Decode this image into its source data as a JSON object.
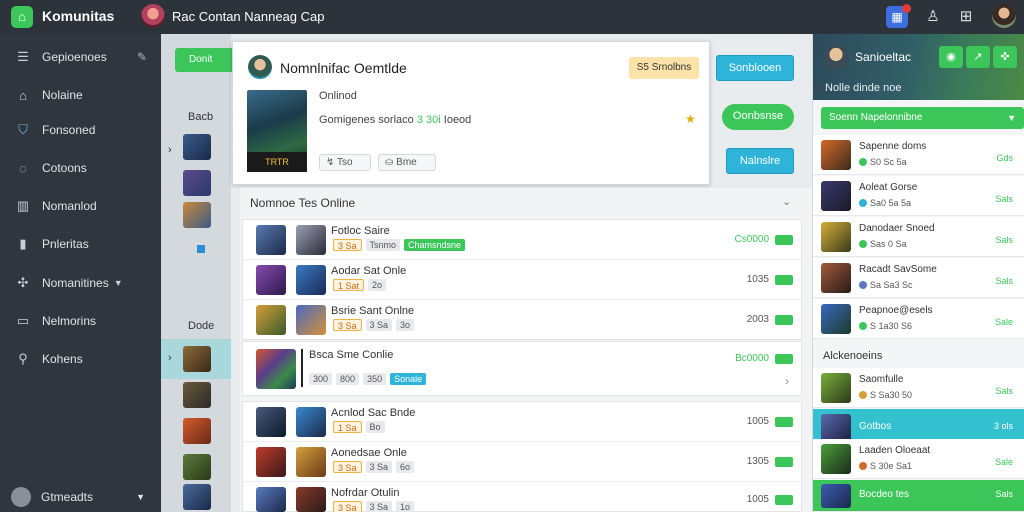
{
  "app": {
    "brand": "Komunitas",
    "title": "Rac Contan Nanneag Cap"
  },
  "topbar": {
    "notif_icon": "notification-icon",
    "user_icon": "user-icon",
    "grid_icon": "grid-icon"
  },
  "sidebar": {
    "items": [
      {
        "label": "Gepioenoes",
        "icon": "menu-icon"
      },
      {
        "label": "Nolaine",
        "icon": "home-icon"
      },
      {
        "label": "Fonsoned",
        "icon": "shield-icon"
      },
      {
        "label": "Cotoons",
        "icon": "chat-icon"
      },
      {
        "label": "Nomanlod",
        "icon": "building-icon"
      },
      {
        "label": "Pnleritas",
        "icon": "bookmark-icon"
      },
      {
        "label": "Nomanitines",
        "icon": "puzzle-icon"
      },
      {
        "label": "Nelmorins",
        "icon": "monitor-icon"
      },
      {
        "label": "Kohens",
        "icon": "location-icon"
      }
    ],
    "footer": "Gtmeadts"
  },
  "under": {
    "button": "Donit",
    "header1": "Bacb",
    "header2": "Dode"
  },
  "popup": {
    "title": "Nomnlnifac Oemtlde",
    "badge": "S5 Srnolbns",
    "status": "Onlinod",
    "desc_prefix": "Gomigenes sorlaco",
    "desc_highlight": "3 30i",
    "desc_suffix": "Ioeod",
    "art_label": "TRTR",
    "tag1": "Tso",
    "tag2": "Bme"
  },
  "actions": {
    "btn1": "Sonblooen",
    "btn2": "Oonbsnse",
    "btn3": "Nalnslre"
  },
  "main": {
    "section": "Nomnoe Tes Online",
    "rows": [
      {
        "name": "Fotloc Saire",
        "tags": [
          "3 Sa",
          "Tsnmo",
          "Chamsndsne"
        ],
        "value": "Cs0000",
        "green": true
      },
      {
        "name": "Aodar Sat Onle",
        "tags": [
          "1 Sat",
          "2o"
        ],
        "value": "1035",
        "green": false
      },
      {
        "name": "Bsrie Sant Onlne",
        "tags": [
          "3 Sa",
          "3 Sa",
          "3o"
        ],
        "value": "2003",
        "green": false
      }
    ],
    "big_row": {
      "name": "Bsca Sme Conlie",
      "tags": [
        "300",
        "800",
        "350",
        "Sonale"
      ],
      "value": "Bc0000"
    },
    "rows2": [
      {
        "name": "Acnlod Sac Bnde",
        "tags": [
          "1 Sa",
          "Bo"
        ],
        "value": "1005"
      },
      {
        "name": "Aonedsae Onle",
        "tags": [
          "3 Sa",
          "3 Sa",
          "6o"
        ],
        "value": "1305"
      },
      {
        "name": "Nofrdar Otulin",
        "tags": [
          "3 Sa",
          "3 Sa",
          "1o"
        ],
        "value": "1005"
      }
    ]
  },
  "right": {
    "name": "Sanioeltac",
    "subtitle": "Nolle dinde noe",
    "dropdown": "Soenn Napelonnibne",
    "rows": [
      {
        "name": "Sapenne doms",
        "meta": "S0 Sc 5a",
        "value": "Gds"
      },
      {
        "name": "Aoleat Gorse",
        "meta": "Sa0 5a 5a",
        "value": "Sals"
      },
      {
        "name": "Danodaer Snoed",
        "meta": "Sas 0 Sa",
        "value": "Sals"
      },
      {
        "name": "Racadt SavSome",
        "meta": "Sa Sa3 Sc",
        "value": "Sals"
      },
      {
        "name": "Peapnoe@esels",
        "meta": "S 1a30 S6",
        "value": "Sale"
      }
    ],
    "section": "Alckenoeins",
    "rows2": [
      {
        "name": "Saomfulle",
        "meta": "S Sa30 50",
        "value": "Sals",
        "style": ""
      },
      {
        "name": "Gotbos",
        "meta": "",
        "value": "3 ols",
        "style": "teal"
      },
      {
        "name": "Laaden Oloeaat",
        "meta": "S 30e Sa1",
        "value": "Sale",
        "style": ""
      },
      {
        "name": "Bocdeo tes",
        "meta": "",
        "value": "Sals",
        "style": "greenrow"
      }
    ]
  }
}
